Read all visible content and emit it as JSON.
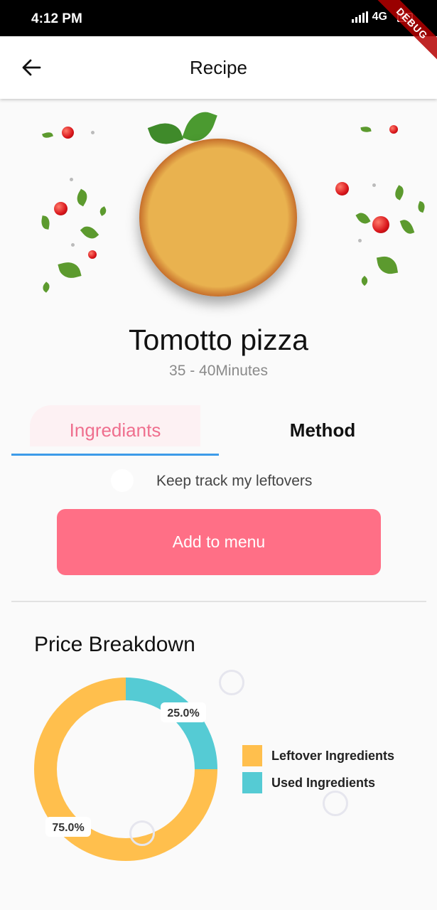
{
  "status_bar": {
    "time": "4:12 PM",
    "network": "4G",
    "debug_label": "DEBUG"
  },
  "app_bar": {
    "title": "Recipe",
    "back_icon": "arrow-back-icon"
  },
  "recipe": {
    "name": "Tomotto pizza",
    "time": "35 - 40Minutes"
  },
  "tabs": [
    {
      "label": "Ingrediants",
      "selected": true
    },
    {
      "label": "Method",
      "selected": false
    }
  ],
  "toggle": {
    "label": "Keep track my leftovers",
    "on": false
  },
  "actions": {
    "add_label": "Add to menu"
  },
  "price_breakdown": {
    "title": "Price Breakdown"
  },
  "chart_data": {
    "type": "pie",
    "style": "donut",
    "title": "",
    "categories": [
      "Leftover Ingredients",
      "Used Ingredients"
    ],
    "values": [
      75.0,
      25.0
    ],
    "data_labels": [
      "75.0%",
      "25.0%"
    ],
    "colors": [
      "#ffbf4d",
      "#55cbd4"
    ],
    "legend_position": "right"
  },
  "colors": {
    "accent_pink": "#ff6f86",
    "tab_text_pink": "#ef6f8e",
    "tab_indicator": "#3d9be9",
    "leftover": "#ffbf4d",
    "used": "#55cbd4"
  }
}
